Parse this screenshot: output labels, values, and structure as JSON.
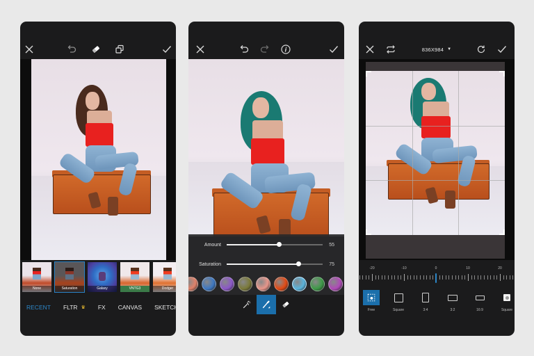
{
  "panels": {
    "effects": {
      "toolbar": {
        "close_icon": "close-icon",
        "undo_icon": "undo-icon",
        "eraser_icon": "eraser-icon",
        "layers_icon": "layers-icon",
        "apply_icon": "check-icon"
      },
      "filters": [
        {
          "label": "None",
          "selected": false
        },
        {
          "label": "Saturation",
          "selected": true
        },
        {
          "label": "Galaxy",
          "selected": false
        },
        {
          "label": "VNTG3",
          "selected": false
        },
        {
          "label": "Dodger",
          "selected": false
        }
      ],
      "categories": [
        {
          "label": "RECENT",
          "active": true
        },
        {
          "label": "FLTR",
          "active": false,
          "badge": "crown-icon"
        },
        {
          "label": "FX",
          "active": false
        },
        {
          "label": "CANVAS",
          "active": false
        },
        {
          "label": "SKETCH",
          "active": false
        }
      ]
    },
    "hair_color": {
      "toolbar": {
        "close_icon": "close-icon",
        "undo_icon": "undo-icon",
        "redo_icon": "redo-icon",
        "info_icon": "info-icon",
        "apply_icon": "check-icon"
      },
      "sliders": [
        {
          "label": "Amount",
          "value": 55,
          "max": 100
        },
        {
          "label": "Saturation",
          "value": 75,
          "max": 100
        }
      ],
      "swatches": [
        "#e0826a",
        "#3e78c2",
        "#8c58c8",
        "#7b7a3a",
        "#e8968a",
        "#e24a14",
        "#5ab4dc",
        "#3e9a48",
        "#b04ab8",
        "#e0826a"
      ],
      "selected_swatch_index": 6,
      "tools": [
        {
          "name": "magic-wand",
          "active": false
        },
        {
          "name": "brush",
          "active": true
        },
        {
          "name": "eraser",
          "active": false
        }
      ]
    },
    "crop": {
      "toolbar": {
        "close_icon": "close-icon",
        "flip_icon": "flip-icon",
        "size_label": "836X984",
        "rotate_icon": "rotate-icon",
        "apply_icon": "check-icon"
      },
      "ruler": {
        "labels": [
          "-20",
          "-10",
          "0",
          "10",
          "20"
        ],
        "value": 0
      },
      "ratios": [
        {
          "label": "Free",
          "active": true
        },
        {
          "label": "Square",
          "active": false
        },
        {
          "label": "3:4",
          "active": false
        },
        {
          "label": "3:2",
          "active": false
        },
        {
          "label": "16:9",
          "active": false
        },
        {
          "label": "Square",
          "active": false
        }
      ]
    }
  },
  "colors": {
    "accent": "#2c87c8",
    "active_tool_bg": "#1b6fab",
    "panel_bg": "#1b1b1c",
    "page_bg": "#e9e9e9",
    "premium_badge": "#f1c232"
  }
}
